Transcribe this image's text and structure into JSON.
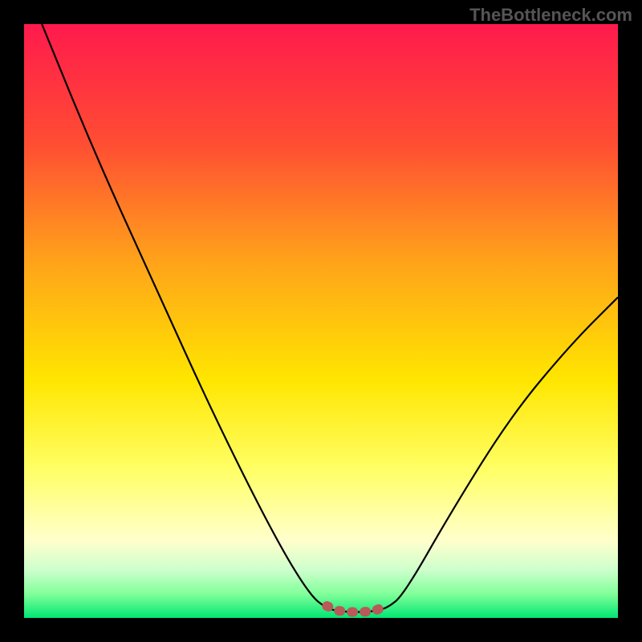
{
  "watermark": "TheBottleneck.com",
  "chart_data": {
    "type": "line",
    "title": "",
    "xlabel": "",
    "ylabel": "",
    "xlim": [
      0,
      100
    ],
    "ylim": [
      0,
      100
    ],
    "gradient_stops": [
      {
        "offset": 0.0,
        "color": "#ff1a4d"
      },
      {
        "offset": 0.2,
        "color": "#ff4d33"
      },
      {
        "offset": 0.4,
        "color": "#ffa31a"
      },
      {
        "offset": 0.6,
        "color": "#ffe600"
      },
      {
        "offset": 0.75,
        "color": "#ffff66"
      },
      {
        "offset": 0.87,
        "color": "#ffffcc"
      },
      {
        "offset": 0.92,
        "color": "#ccffcc"
      },
      {
        "offset": 0.96,
        "color": "#80ff99"
      },
      {
        "offset": 1.0,
        "color": "#00e673"
      }
    ],
    "series": [
      {
        "name": "bottleneck-curve",
        "points": [
          {
            "x": 3,
            "y": 100
          },
          {
            "x": 12,
            "y": 78
          },
          {
            "x": 22,
            "y": 56
          },
          {
            "x": 32,
            "y": 34
          },
          {
            "x": 42,
            "y": 14
          },
          {
            "x": 48,
            "y": 4
          },
          {
            "x": 51,
            "y": 1.5
          },
          {
            "x": 54,
            "y": 1
          },
          {
            "x": 58,
            "y": 1
          },
          {
            "x": 61,
            "y": 1.5
          },
          {
            "x": 64,
            "y": 4
          },
          {
            "x": 72,
            "y": 18
          },
          {
            "x": 82,
            "y": 34
          },
          {
            "x": 92,
            "y": 46
          },
          {
            "x": 100,
            "y": 54
          }
        ]
      }
    ],
    "marker": {
      "name": "optimal-range",
      "color": "#b85a5a",
      "points": [
        {
          "x": 51,
          "y": 2.0
        },
        {
          "x": 53,
          "y": 1.2
        },
        {
          "x": 55,
          "y": 1.0
        },
        {
          "x": 57,
          "y": 1.0
        },
        {
          "x": 59,
          "y": 1.2
        },
        {
          "x": 61,
          "y": 2.0
        }
      ]
    }
  }
}
